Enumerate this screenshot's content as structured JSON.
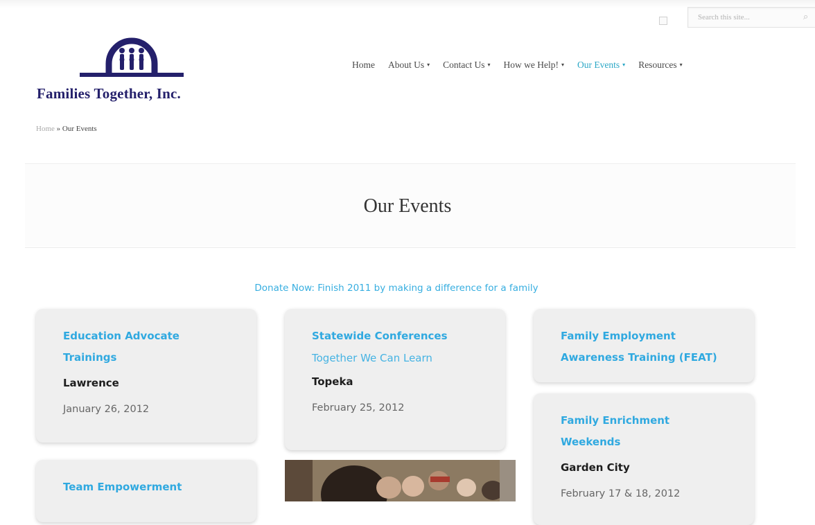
{
  "header": {
    "search_placeholder": "Search this site...",
    "logo_text": "Families Together, Inc."
  },
  "nav": {
    "items": [
      {
        "label": "Home",
        "has_dropdown": false
      },
      {
        "label": "About Us",
        "has_dropdown": true
      },
      {
        "label": "Contact Us",
        "has_dropdown": true
      },
      {
        "label": "How we Help!",
        "has_dropdown": true
      },
      {
        "label": "Our Events",
        "has_dropdown": true,
        "active": true
      },
      {
        "label": "Resources",
        "has_dropdown": true
      }
    ],
    "caret": "▾"
  },
  "breadcrumb": {
    "home": "Home",
    "separator": "»",
    "current": "Our Events"
  },
  "page": {
    "title": "Our Events",
    "donate_link": "Donate Now: Finish 2011 by making a difference for a family"
  },
  "events": {
    "education": {
      "title_line1": "Education Advocate",
      "title_line2": "Trainings",
      "city": "Lawrence",
      "date": "January 26, 2012"
    },
    "statewide": {
      "title": "Statewide Conferences",
      "subtitle": "Together We Can Learn",
      "city": "Topeka",
      "date": "February 25, 2012"
    },
    "feat": {
      "title_line1": "Family Employment",
      "title_line2": "Awareness Training (FEAT)"
    },
    "enrichment": {
      "title_line1": "Family Enrichment",
      "title_line2": "Weekends",
      "city": "Garden City",
      "date": "February 17 & 18, 2012"
    },
    "team": {
      "title": "Team Empowerment"
    }
  },
  "colors": {
    "accent": "#30a9e0",
    "nav_active": "#2ba7c6",
    "logo_navy": "#24206b"
  }
}
